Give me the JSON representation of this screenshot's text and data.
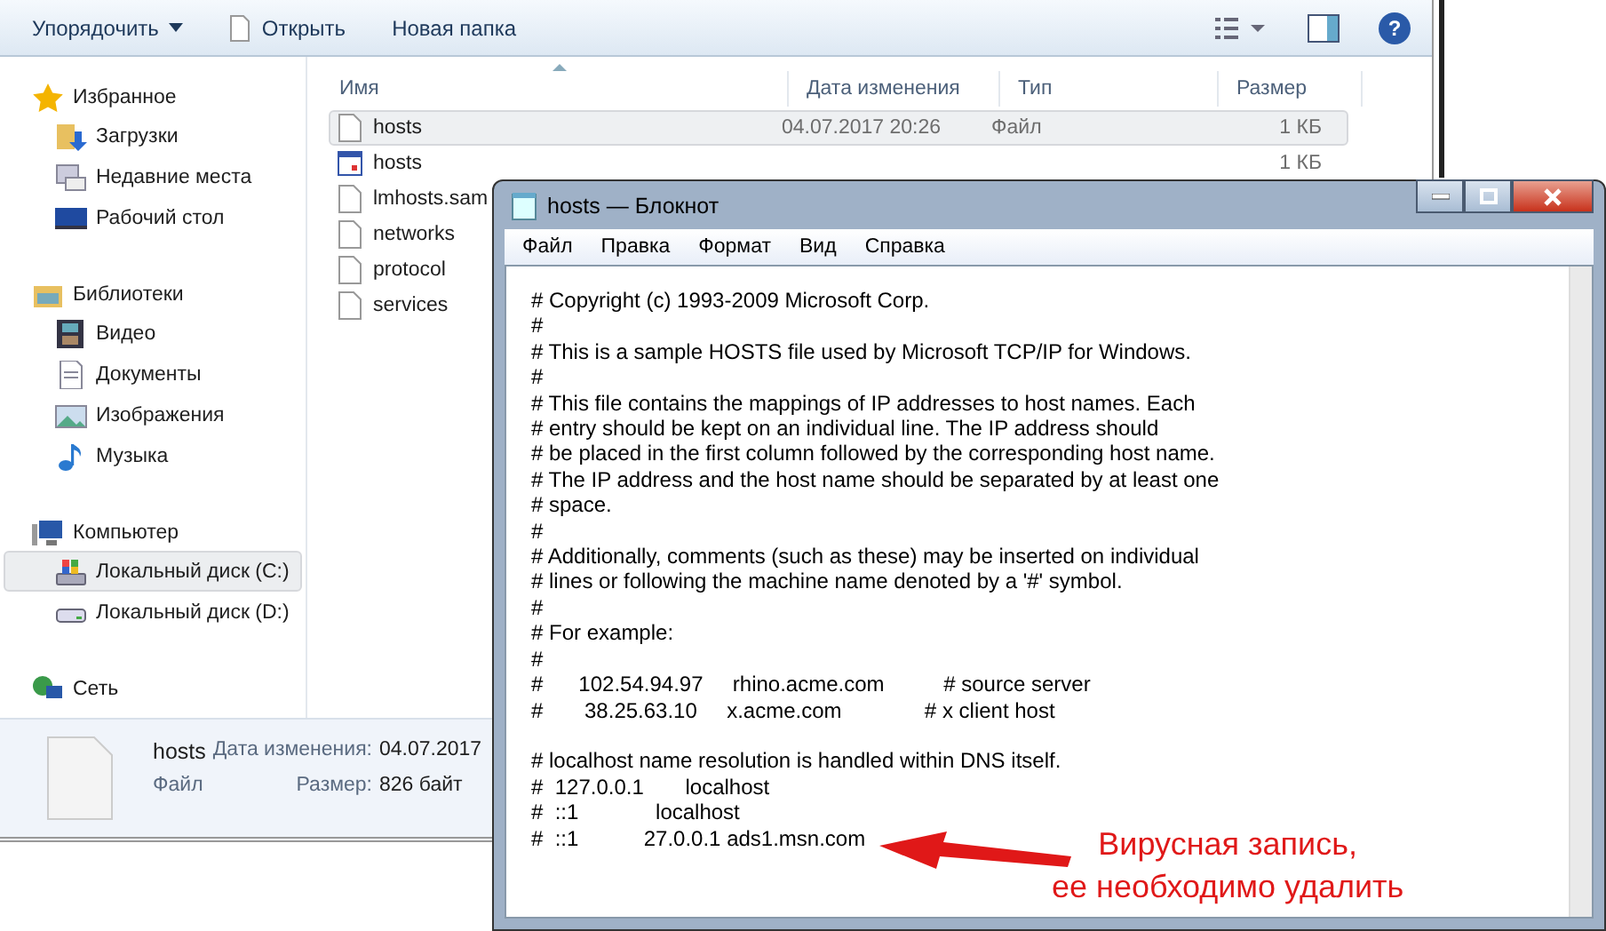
{
  "explorer": {
    "toolbar": {
      "organize": "Упорядочить",
      "open": "Открыть",
      "new_folder": "Новая папка",
      "help": "?"
    },
    "columns": [
      "Имя",
      "Дата изменения",
      "Тип",
      "Размер"
    ],
    "sidebar": [
      {
        "label": "Избранное",
        "children": [
          {
            "label": "Загрузки",
            "selected": false
          },
          {
            "label": "Недавние места",
            "selected": false
          },
          {
            "label": "Рабочий стол",
            "selected": false
          }
        ]
      },
      {
        "label": "Библиотеки",
        "children": [
          {
            "label": "Видео",
            "selected": false
          },
          {
            "label": "Документы",
            "selected": false
          },
          {
            "label": "Изображения",
            "selected": false
          },
          {
            "label": "Музыка",
            "selected": false
          }
        ]
      },
      {
        "label": "Компьютер",
        "children": [
          {
            "label": "Локальный диск (C:)",
            "selected": true
          },
          {
            "label": "Локальный диск (D:)",
            "selected": false
          }
        ]
      },
      {
        "label": "Сеть"
      }
    ],
    "files": [
      {
        "name": "hosts",
        "date": "04.07.2017 20:26",
        "type": "Файл",
        "size": "1 КБ",
        "selected": true
      },
      {
        "name": "hosts",
        "size": "1 КБ",
        "selected": false
      },
      {
        "name": "lmhosts.sam",
        "selected": false
      },
      {
        "name": "networks",
        "selected": false
      },
      {
        "name": "protocol",
        "selected": false
      },
      {
        "name": "services",
        "selected": false
      }
    ],
    "details": {
      "name": "hosts",
      "date_label": "Дата изменения:",
      "date": "04.07.2017",
      "type": "Файл",
      "size_label": "Размер:",
      "size": "826 байт"
    }
  },
  "notepad": {
    "title": "hosts — Блокнот",
    "menu": [
      "Файл",
      "Правка",
      "Формат",
      "Вид",
      "Справка"
    ],
    "text_blocks": [
      [
        "# Copyright (c) 1993-2009 Microsoft Corp.",
        "#",
        "# This is a sample HOSTS file used by Microsoft TCP/IP for Windows.",
        "#",
        "# This file contains the mappings of IP addresses to host names. Each",
        "# entry should be kept on an individual line. The IP address should",
        "# be placed in the first column followed by the corresponding host name.",
        "# The IP address and the host name should be separated by at least one",
        "# space.",
        "#",
        "# Additionally, comments (such as these) may be inserted on individual",
        "# lines or following the machine name denoted by a '#' symbol.",
        "#",
        "# For example:",
        "#",
        "#      102.54.94.97     rhino.acme.com          # source server",
        "#       38.25.63.10     x.acme.com              # x client host"
      ],
      [
        "# localhost name resolution is handled within DNS itself.",
        "#  127.0.0.1       localhost",
        "#  ::1             localhost",
        "#  ::1           27.0.0.1 ads1.msn.com"
      ]
    ]
  },
  "annotation": {
    "lines": [
      "Вирусная запись,",
      "ее необходимо удалить"
    ]
  }
}
